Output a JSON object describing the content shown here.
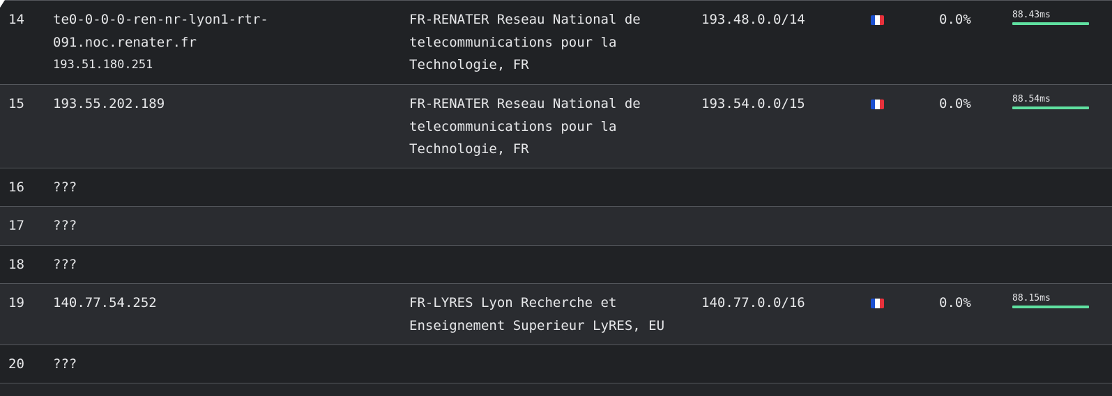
{
  "colors": {
    "background": "#242629",
    "row_odd": "#202225",
    "row_even": "#2a2c30",
    "divider": "#55585d",
    "text": "#e6e7e9",
    "latency_bar": "#5fe0a0",
    "flag_blue": "#1a4fd0",
    "flag_white": "#ffffff",
    "flag_red": "#e8323c"
  },
  "rows": [
    {
      "hop": "14",
      "host_lines": [
        "te0-0-0-0-ren-nr-lyon1-rtr-",
        "091.noc.renater.fr"
      ],
      "ip": "193.51.180.251",
      "asn_lines": [
        "FR-RENATER Reseau National de",
        "telecommunications pour la",
        "Technologie, FR"
      ],
      "prefix": "193.48.0.0/14",
      "flag": "flag-fr-icon",
      "loss": "0.0%",
      "latency": "88.43ms",
      "latency_fill": 1.0
    },
    {
      "hop": "15",
      "host_lines": [
        "193.55.202.189"
      ],
      "ip": "",
      "asn_lines": [
        "FR-RENATER Reseau National de",
        "telecommunications pour la",
        "Technologie, FR"
      ],
      "prefix": "193.54.0.0/15",
      "flag": "flag-fr-icon",
      "loss": "0.0%",
      "latency": "88.54ms",
      "latency_fill": 1.0
    },
    {
      "hop": "16",
      "host_lines": [
        "???"
      ]
    },
    {
      "hop": "17",
      "host_lines": [
        "???"
      ]
    },
    {
      "hop": "18",
      "host_lines": [
        "???"
      ]
    },
    {
      "hop": "19",
      "host_lines": [
        "140.77.54.252"
      ],
      "ip": "",
      "asn_lines": [
        "FR-LYRES Lyon Recherche et",
        "Enseignement Superieur LyRES, EU"
      ],
      "prefix": "140.77.0.0/16",
      "flag": "flag-fr-icon",
      "loss": "0.0%",
      "latency": "88.15ms",
      "latency_fill": 1.0
    },
    {
      "hop": "20",
      "host_lines": [
        "???"
      ]
    }
  ]
}
